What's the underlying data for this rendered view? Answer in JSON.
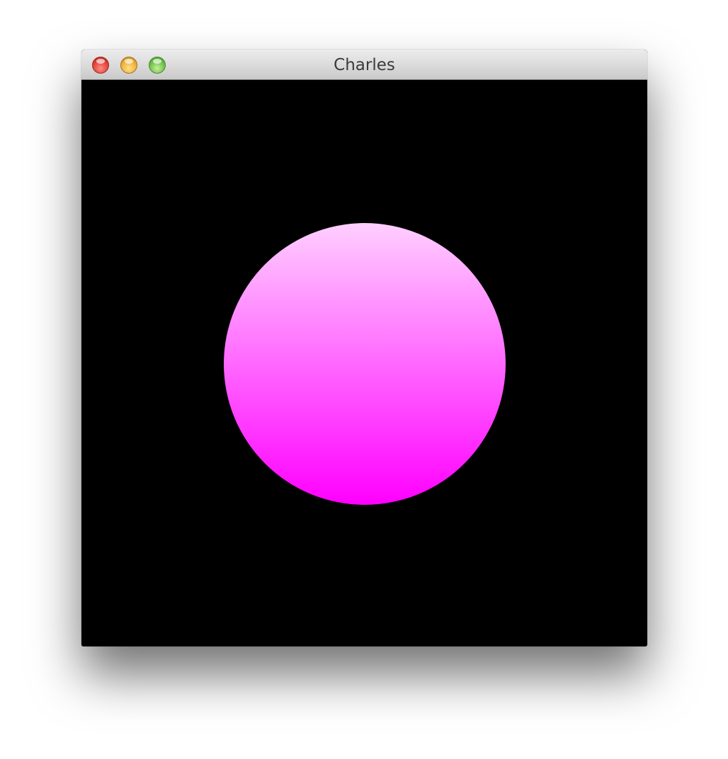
{
  "window": {
    "title": "Charles",
    "controls": {
      "close": "close-button",
      "minimize": "minimize-button",
      "zoom": "zoom-button"
    }
  },
  "canvas": {
    "background_color": "#000000",
    "shape": "circle",
    "gradient_top_color": "#ffcfff",
    "gradient_bottom_color": "#ff00ff"
  }
}
